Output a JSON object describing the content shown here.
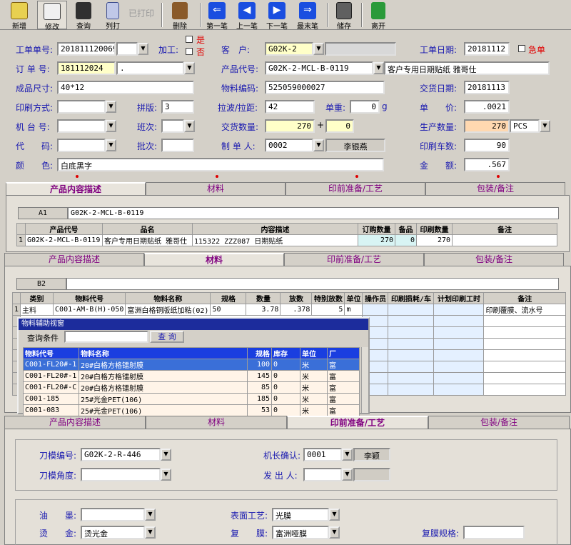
{
  "toolbar": {
    "new": "新增",
    "edit": "修改",
    "query": "查询",
    "list": "列打",
    "printed": "已打印",
    "delete": "删除",
    "first": "第一笔",
    "prev": "上一笔",
    "next": "下一笔",
    "last": "最末笔",
    "save": "储存",
    "exit": "离开"
  },
  "form": {
    "work_no_label": "工单单号:",
    "work_no": "201811120069",
    "process_label": "加工:",
    "process_yes": "是",
    "process_no": "否",
    "customer_label": "客　户:",
    "customer": "G02K-2",
    "work_date_label": "工单日期:",
    "work_date": "20181112",
    "urgent_label": "急单",
    "order_no_label": "订 单 号:",
    "order_no": "181112024",
    "order_sub": ".",
    "product_code_label": "产品代号:",
    "product_code": "G02K-2-MCL-B-0119",
    "product_name": "客户专用日期贴纸 雅哥仕",
    "size_label": "成品尺寸:",
    "size": "40*12",
    "material_code_label": "物料编码:",
    "material_code": "525059000027",
    "delivery_date_label": "交货日期:",
    "delivery_date": "20181113",
    "print_method_label": "印刷方式:",
    "imposition_label": "拼版:",
    "imposition": "3",
    "pull_label": "拉波/拉距:",
    "pull": "42",
    "unit_weight_label": "单重:",
    "unit_weight": "0",
    "unit_weight_unit": "g",
    "price_label": "单　　价:",
    "price": ".0021",
    "machine_label": "机 台 号:",
    "shift_label": "班次:",
    "qty_label": "交货数量:",
    "qty": "270",
    "plus": "+",
    "qty_extra": "0",
    "prod_qty_label": "生产数量:",
    "prod_qty": "270",
    "prod_unit": "PCS",
    "code_label": "代　　码:",
    "batch_label": "批次:",
    "maker_label": "制 单 人:",
    "maker": "0002",
    "maker_name": "李银燕",
    "print_count_label": "印刷车数:",
    "print_count": "90",
    "color_label": "颜　　色:",
    "color": "白底黑字",
    "amount_label": "金　　额:",
    "amount": ".567"
  },
  "tabs": [
    "产品内容描述",
    "材料",
    "印前准备/工艺",
    "包装/备注"
  ],
  "panel1": {
    "cell_ref": "A1",
    "cell_val": "G02K-2-MCL-B-0119",
    "headers": [
      "",
      "产品代号",
      "品名",
      "内容描述",
      "订购数量",
      "备品",
      "印刷数量",
      "备注"
    ],
    "row": [
      "1",
      "G02K-2-MCL-B-0119",
      "客户专用日期贴纸 雅哥仕",
      "115322 ZZZ087 日期贴纸",
      "270",
      "0",
      "270",
      ""
    ]
  },
  "panel2": {
    "cell_ref": "B2",
    "headers": [
      "",
      "类别",
      "物料代号",
      "物料名称",
      "规格",
      "数量",
      "放数",
      "特别放数",
      "单位",
      "操作员",
      "印刷损耗/车",
      "计划印刷工时",
      "备注"
    ],
    "row": [
      "1",
      "主料",
      "C001-AM-B(H)-050",
      "富洲白格铜版纸加粘(02)",
      "50",
      "3.78",
      ".378",
      "5",
      "m",
      "",
      "",
      "",
      "印刷覆膜、流水号"
    ]
  },
  "popup": {
    "title": "物料辅助视窗",
    "query_label": "查询条件",
    "query_btn": "查 询",
    "headers": [
      "物料代号",
      "物料名称",
      "规格",
      "库存",
      "单位",
      "厂"
    ],
    "rows": [
      [
        "C001-FL20#-1",
        "20#白格方格镭射膜",
        "100",
        "0",
        "米",
        "富"
      ],
      [
        "C001-FL20#-1",
        "20#白格方格镭射膜",
        "145",
        "0",
        "米",
        "富"
      ],
      [
        "C001-FL20#-C",
        "20#白格方格镭射膜",
        "85",
        "0",
        "米",
        "富"
      ],
      [
        "C001-185",
        "25#光金PET(106)",
        "185",
        "0",
        "米",
        "富"
      ],
      [
        "C001-083",
        "25#光金PET(106)",
        "53",
        "0",
        "米",
        "富"
      ]
    ]
  },
  "panel3": {
    "die_no_label": "刀模编号:",
    "die_no": "G02K-2-R-446",
    "die_angle_label": "刀模角度:",
    "captain_label": "机长确认:",
    "captain": "0001",
    "captain_name": "李颖",
    "issuer_label": "发 出 人:",
    "oil_label": "油　　墨:",
    "surface_label": "表面工艺:",
    "surface": "光膜",
    "hot_label": "烫　　金:",
    "hot": "烫光金",
    "laminate_label": "复　　膜:",
    "laminate": "富洲哑膜",
    "laminate_spec_label": "复膜规格:"
  },
  "colors": {
    "label": "#1a1ab0",
    "tab_text": "#800080",
    "highlight_row": "#3a6fd8",
    "popup_title": "#1c2c9c"
  }
}
